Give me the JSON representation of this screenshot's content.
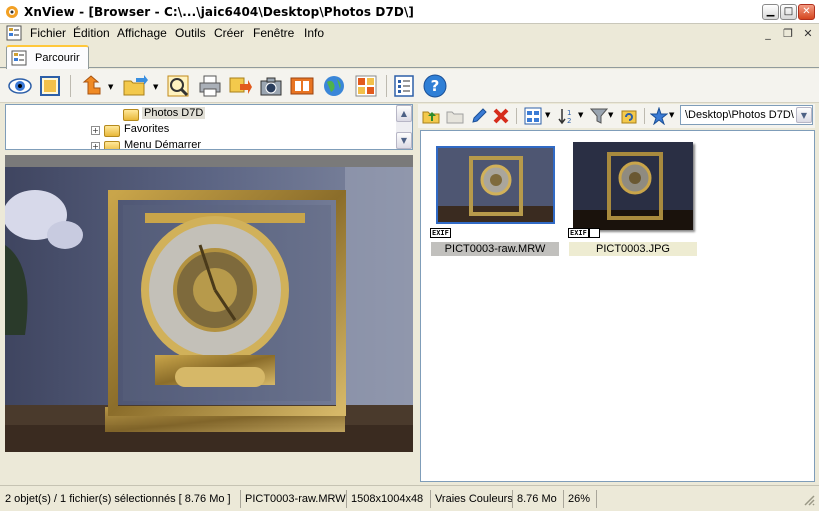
{
  "window": {
    "title": "XnView - [Browser - C:\\...\\jaic6404\\Desktop\\Photos D7D\\]"
  },
  "menu": [
    "Fichier",
    "Édition",
    "Affichage",
    "Outils",
    "Créer",
    "Fenêtre",
    "Info"
  ],
  "tabs": [
    {
      "label": "Parcourir"
    }
  ],
  "tree": {
    "items": [
      {
        "label": "Photos D7D",
        "selected": true
      },
      {
        "label": "Favorites"
      },
      {
        "label": "Menu Démarrer"
      }
    ]
  },
  "right_toolbar": {
    "path": "\\Desktop\\Photos D7D\\"
  },
  "files": [
    {
      "name": "PICT0003-raw.MRW",
      "badge": "EXIF",
      "selected": true
    },
    {
      "name": "PICT0003.JPG",
      "badge": "EXIF",
      "selected": false
    }
  ],
  "status": {
    "selection": "2 objet(s) / 1 fichier(s) sélectionnés  [ 8.76 Mo ]",
    "filename": "PICT0003-raw.MRW",
    "dimensions": "1508x1004x48",
    "colors": "Vraies Couleurs",
    "size": "8.76 Mo",
    "zoom": "26%"
  },
  "icons": [
    "xnview-logo-icon",
    "minimize-icon",
    "maximize-icon",
    "close-icon",
    "view-icon",
    "fullscreen-icon",
    "go-up-icon",
    "open-folder-icon",
    "acquire-icon",
    "print-icon",
    "convert-icon",
    "camera-icon",
    "slideshow-icon",
    "web-icon",
    "contact-sheet-icon",
    "settings-icon",
    "help-icon"
  ]
}
